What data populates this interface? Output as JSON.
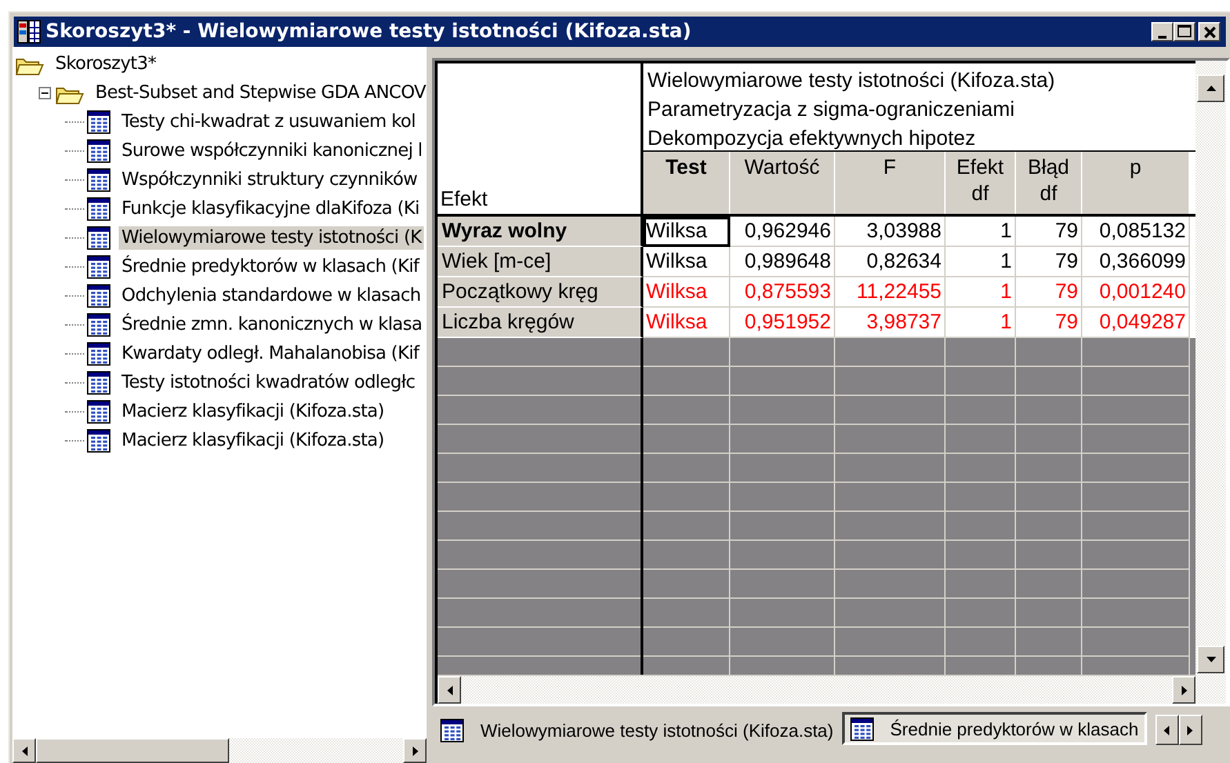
{
  "window": {
    "title": "Skoroszyt3* - Wielowymiarowe testy istotności (Kifoza.sta)"
  },
  "tree": {
    "label": "Skoroszyt3*",
    "children": [
      {
        "label": "Best-Subset and Stepwise GDA ANCOV",
        "expanded": true,
        "children": [
          {
            "label": "Testy chi-kwadrat z usuwaniem kol",
            "selected": false
          },
          {
            "label": "Surowe współczynniki kanonicznej l",
            "selected": false
          },
          {
            "label": "Współczynniki struktury czynników",
            "selected": false
          },
          {
            "label": "Funkcje klasyfikacyjne dlaKifoza (Ki",
            "selected": false
          },
          {
            "label": "Wielowymiarowe testy istotności (K",
            "selected": true
          },
          {
            "label": "Średnie predyktorów w klasach (Kif",
            "selected": false
          },
          {
            "label": "Odchylenia standardowe w klasach",
            "selected": false
          },
          {
            "label": "Średnie zmn. kanonicznych w klasa",
            "selected": false
          },
          {
            "label": "Kwardaty odległ. Mahalanobisa (Kif",
            "selected": false
          },
          {
            "label": "Testy istotności kwadratów odległc",
            "selected": false
          },
          {
            "label": "Macierz klasyfikacji (Kifoza.sta)",
            "selected": false
          },
          {
            "label": "Macierz klasyfikacji (Kifoza.sta)",
            "selected": false
          }
        ]
      }
    ]
  },
  "spreadsheet": {
    "titles": [
      "Wielowymiarowe testy istotności (Kifoza.sta)",
      "Parametryzacja z sigma-ograniczeniami",
      "Dekompozycja efektywnych hipotez"
    ],
    "row_header_title": "Efekt",
    "columns": [
      {
        "label": "Test",
        "bold": true
      },
      {
        "label": "Wartość",
        "bold": false
      },
      {
        "label": "F",
        "bold": false
      },
      {
        "label": "Efekt df",
        "bold": false
      },
      {
        "label": "Błąd df",
        "bold": false
      },
      {
        "label": "p",
        "bold": false
      }
    ],
    "rows": [
      {
        "effect": "Wyraz wolny",
        "bold": true,
        "significant": false,
        "focused": true,
        "cells": [
          "Wilksa",
          "0,962946",
          "3,03988",
          "1",
          "79",
          "0,085132"
        ]
      },
      {
        "effect": "Wiek [m-ce]",
        "bold": false,
        "significant": false,
        "focused": false,
        "cells": [
          "Wilksa",
          "0,989648",
          "0,82634",
          "1",
          "79",
          "0,366099"
        ]
      },
      {
        "effect": "Początkowy kręg",
        "bold": false,
        "significant": true,
        "focused": false,
        "cells": [
          "Wilksa",
          "0,875593",
          "11,22455",
          "1",
          "79",
          "0,001240"
        ]
      },
      {
        "effect": "Liczba kręgów",
        "bold": false,
        "significant": true,
        "focused": false,
        "cells": [
          "Wilksa",
          "0,951952",
          "3,98737",
          "1",
          "79",
          "0,049287"
        ]
      }
    ]
  },
  "tabs": [
    {
      "label": "Wielowymiarowe testy istotności (Kifoza.sta)",
      "selected": true
    },
    {
      "label": "Średnie predyktorów w klasach",
      "selected": false
    }
  ]
}
